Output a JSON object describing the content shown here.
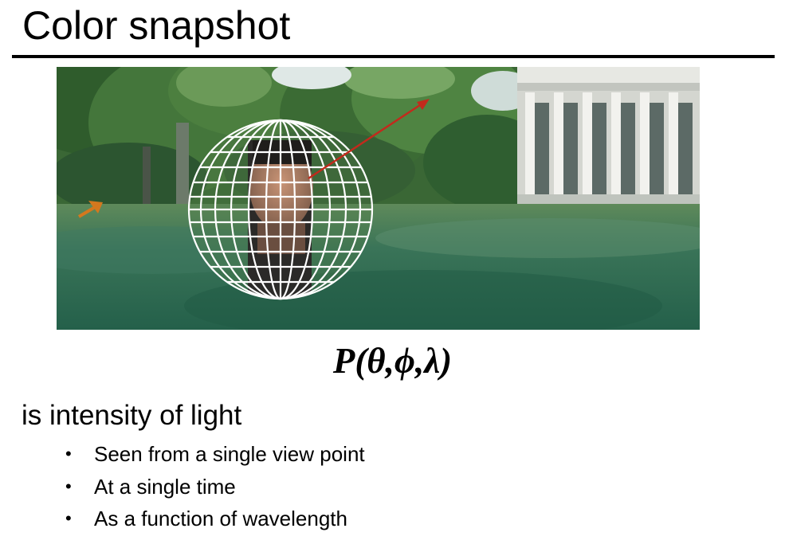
{
  "slide": {
    "title": "Color snapshot",
    "formula": "P(θ,ϕ,λ)",
    "subtitle": "is intensity of light",
    "bullet_glyph": "•",
    "bullets": [
      "Seen from a single view point",
      "At a single time",
      "As a function of wavelength"
    ]
  },
  "photo": {
    "alt": "Wireframe sphere around a person's head on a campus lawn with an arrow pointing from the eye toward the trees",
    "colors": {
      "sky": "#e4ecf0",
      "trees": "#3c6a38",
      "grass": "#2f6650",
      "building": "#d9dbd6",
      "sphere_grid": "#ffffff",
      "arrow": "#c22a1c",
      "small_arrow": "#d4781e"
    }
  }
}
